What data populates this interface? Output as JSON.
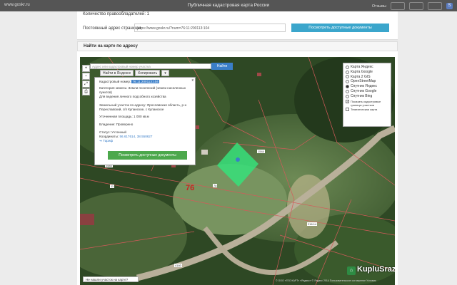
{
  "topbar": {
    "site": "www.goskr.ru",
    "title": "Публичная кадастровая карта России",
    "feedback": "Отзывы",
    "s_badge": "S"
  },
  "info_card": {
    "owners_count": "Количество правообладателей: 1",
    "permalink_label": "Постоянный адрес страницы",
    "permalink_value": "https://www.goskr.ru/?num=76:11:200113:104",
    "docs_button": "Посмотреть доступные документы"
  },
  "find_section": {
    "title": "Найти на карте по адресу"
  },
  "map": {
    "search_placeholder": "Адрес или кадастровый номер участка",
    "search_button": "Найти",
    "find_in_yandex": "Найти в Яндексе",
    "copy_button": "Копировать",
    "tools": [
      "+",
      "−",
      "⤢",
      "⎙"
    ],
    "popup": {
      "cad_label": "Кадастровый номер:",
      "cad_value": "76:11:200113:104",
      "category": "Категория земель: Земли поселений (земли населенных пунктов)",
      "usage": "Для ведения личного подсобного хозяйства",
      "address": "Земельный участок по адресу: Ярославская область, р-н Переславский, с/п Купанское, с Купанское",
      "area": "Уточненная площадь: 1 000 кв.м",
      "owner": "Владение: Проверено",
      "status": "Статус: Учтенный",
      "coords_label": "Координаты:",
      "coords_value": "56.617614, 38.558627",
      "tariff_link": "Тариф",
      "docs_button": "Посмотреть доступные документы",
      "close": "x"
    },
    "layers": [
      {
        "label": "Карта Яндекс",
        "selected": false
      },
      {
        "label": "Карта Google",
        "selected": false
      },
      {
        "label": "Карта 2 GIS",
        "selected": false
      },
      {
        "label": "OpenStreetMap",
        "selected": false
      },
      {
        "label": "Спутник Яндекс",
        "selected": true
      },
      {
        "label": "Спутник Google",
        "selected": false
      },
      {
        "label": "Спутник Bing",
        "selected": false
      }
    ],
    "layer_checks": [
      {
        "label": "Показать кадастровые границы участков",
        "checked": true
      },
      {
        "label": "Тематическая карта",
        "checked": false
      }
    ],
    "labels": {
      "num76": "76",
      "l1": "11",
      "l2": "2583",
      "l3": "1544",
      "l4": "4160",
      "l5": "216:14",
      "l6": "78"
    },
    "not_found": "Не нашли участок на карте?",
    "copyright": "© ООО «ГЕО КАРТ» «Яндекс»  © Яндекс 2014  Пользовательское соглашение  Условия",
    "watermark": "KupluSrazu.ru"
  }
}
